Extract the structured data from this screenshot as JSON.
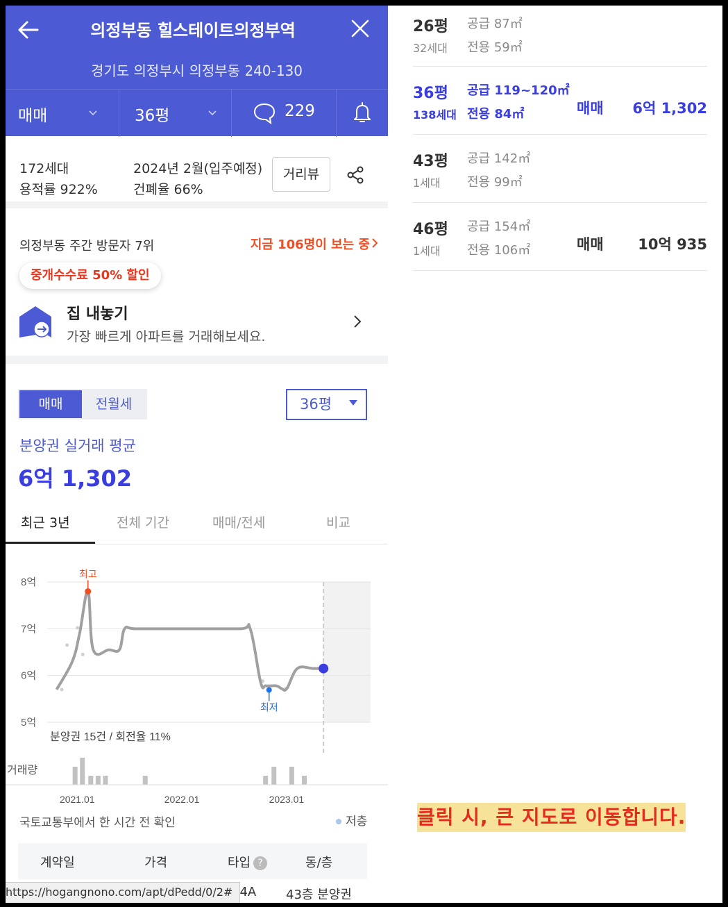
{
  "header": {
    "title": "의정부동 힐스테이트의정부역",
    "address": "경기도 의정부시 의정부동 240-130",
    "trade_type": "매매",
    "size": "36평",
    "comment_count": "229"
  },
  "info": {
    "households": "172세대",
    "floor_area_ratio": "용적률 922%",
    "move_in": "2024년 2월(입주예정)",
    "coverage_ratio": "건폐율 66%",
    "street_view": "거리뷰"
  },
  "visitors": {
    "rank_text": "의정부동 주간 방문자 7위",
    "now_viewing": "지금 106명이 보는 중"
  },
  "promo": {
    "badge": "중개수수료 50% 할인",
    "title": "집 내놓기",
    "subtitle": "가장 빠르게 아파트를 거래해보세요."
  },
  "filter": {
    "seg_active": "매매",
    "seg_other": "전월세",
    "size_select": "36평"
  },
  "summary": {
    "label": "분양권 실거래 평균",
    "value": "6억 1,302"
  },
  "tabs": [
    "최근 3년",
    "전체 기간",
    "매매/전세",
    "비교"
  ],
  "chart_data": {
    "type": "line",
    "y_ticks": [
      "8억",
      "7억",
      "6억",
      "5억"
    ],
    "ylim": [
      5,
      8
    ],
    "x_ticks": [
      "2021.01",
      "2022.01",
      "2023.01"
    ],
    "annotations": {
      "high": "최고",
      "low": "최저"
    },
    "stats_text": "분양권 15건 / 회전율 11%",
    "volume_label": "거래량",
    "series": [
      {
        "x": [
          2020.75,
          2020.9,
          2020.97,
          2021.05,
          2021.1,
          2021.25,
          2021.35,
          2021.4,
          2021.5,
          2021.9,
          2022.5,
          2022.6,
          2022.7,
          2022.75,
          2022.85,
          2022.9,
          2022.95,
          2023.05,
          2023.2,
          2023.3
        ],
        "y": [
          5.7,
          6.3,
          6.9,
          7.8,
          6.55,
          6.55,
          6.55,
          7.0,
          7.0,
          7.0,
          7.0,
          7.0,
          5.85,
          5.78,
          5.78,
          5.72,
          5.72,
          6.15,
          6.15,
          6.15
        ]
      }
    ],
    "points": [
      {
        "x": 2020.8,
        "y": 5.7
      },
      {
        "x": 2020.85,
        "y": 6.65
      },
      {
        "x": 2020.95,
        "y": 7.02
      },
      {
        "x": 2021.0,
        "y": 6.45
      },
      {
        "x": 2022.72,
        "y": 5.88
      },
      {
        "x": 2022.94,
        "y": 5.72
      }
    ],
    "volume": [
      {
        "x": 2020.93,
        "v": 2
      },
      {
        "x": 2021.0,
        "v": 3
      },
      {
        "x": 2021.08,
        "v": 1
      },
      {
        "x": 2021.15,
        "v": 1
      },
      {
        "x": 2021.22,
        "v": 1
      },
      {
        "x": 2021.6,
        "v": 1
      },
      {
        "x": 2022.75,
        "v": 1
      },
      {
        "x": 2022.83,
        "v": 2
      },
      {
        "x": 2023.0,
        "v": 2
      },
      {
        "x": 2023.12,
        "v": 1
      }
    ],
    "xlim": [
      2020.7,
      2023.75
    ],
    "current_x": 2023.3,
    "future_shade_from": 2023.3
  },
  "source": {
    "text": "국토교통부에서 한 시간 전 확인",
    "legend_low": "저층"
  },
  "table": {
    "headers": [
      "계약일",
      "가격",
      "타입",
      "동/층"
    ],
    "help": "?",
    "row": {
      "type": "34A",
      "floor": "43층 분양권"
    }
  },
  "status_url": "https://hogangnono.com/apt/dPedd/0/2#",
  "size_list": [
    {
      "pyeong": "26평",
      "households": "32세대",
      "supply": "공급 87㎡",
      "exclusive": "전용 59㎡",
      "trade": "",
      "price": "",
      "selected": false
    },
    {
      "pyeong": "36평",
      "households": "138세대",
      "supply": "공급 119~120㎡",
      "exclusive": "전용 84㎡",
      "trade": "매매",
      "price": "6억 1,302",
      "selected": true
    },
    {
      "pyeong": "43평",
      "households": "1세대",
      "supply": "공급 142㎡",
      "exclusive": "전용 99㎡",
      "trade": "",
      "price": "",
      "selected": false
    },
    {
      "pyeong": "46평",
      "households": "1세대",
      "supply": "공급 154㎡",
      "exclusive": "전용 106㎡",
      "trade": "매매",
      "price": "10억 935",
      "selected": false
    }
  ],
  "notice": "클릭 시, 큰 지도로 이동합니다.",
  "colors": {
    "brand": "#4c5bd4",
    "accent_red": "#f04e23",
    "line": "#a0a0a0",
    "current": "#3a3ee0"
  }
}
